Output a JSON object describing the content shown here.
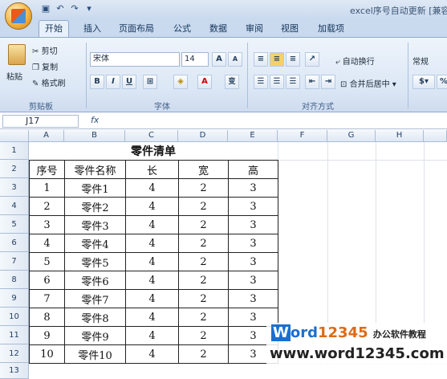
{
  "title_bar": {
    "window_title": "excel序号自动更新 [兼容"
  },
  "tabs": [
    "开始",
    "插入",
    "页面布局",
    "公式",
    "数据",
    "审阅",
    "视图",
    "加载项"
  ],
  "ribbon": {
    "clipboard": {
      "paste": "粘贴",
      "cut": "剪切",
      "copy": "复制",
      "format_painter": "格式刷",
      "label": "剪贴板"
    },
    "font": {
      "name": "宋体",
      "size": "14",
      "label": "字体",
      "bold": "B",
      "italic": "I",
      "underline": "U",
      "grow": "A",
      "shrink": "A",
      "phonetic": "变"
    },
    "alignment": {
      "wrap": "自动换行",
      "merge": "合并后居中",
      "label": "对齐方式"
    },
    "number": {
      "format": "常规"
    }
  },
  "formula_bar": {
    "name_box": "J17",
    "fx": "fx"
  },
  "columns": [
    "A",
    "B",
    "C",
    "D",
    "E",
    "F",
    "G",
    "H"
  ],
  "rows": [
    "1",
    "2",
    "3",
    "4",
    "5",
    "6",
    "7",
    "8",
    "9",
    "10",
    "11",
    "12",
    "13"
  ],
  "table": {
    "title": "零件清单",
    "headers": [
      "序号",
      "零件名称",
      "长",
      "宽",
      "高"
    ],
    "data": [
      [
        "1",
        "零件1",
        "4",
        "2",
        "3"
      ],
      [
        "2",
        "零件2",
        "4",
        "2",
        "3"
      ],
      [
        "3",
        "零件3",
        "4",
        "2",
        "3"
      ],
      [
        "4",
        "零件4",
        "4",
        "2",
        "3"
      ],
      [
        "5",
        "零件5",
        "4",
        "2",
        "3"
      ],
      [
        "6",
        "零件6",
        "4",
        "2",
        "3"
      ],
      [
        "7",
        "零件7",
        "4",
        "2",
        "3"
      ],
      [
        "8",
        "零件8",
        "4",
        "2",
        "3"
      ],
      [
        "9",
        "零件9",
        "4",
        "2",
        "3"
      ],
      [
        "10",
        "零件10",
        "4",
        "2",
        "3"
      ]
    ]
  },
  "watermark": {
    "w": "W",
    "ord": "ord",
    "num": "12345",
    "cn": "办公软件教程",
    "url": "www.word12345.com"
  }
}
